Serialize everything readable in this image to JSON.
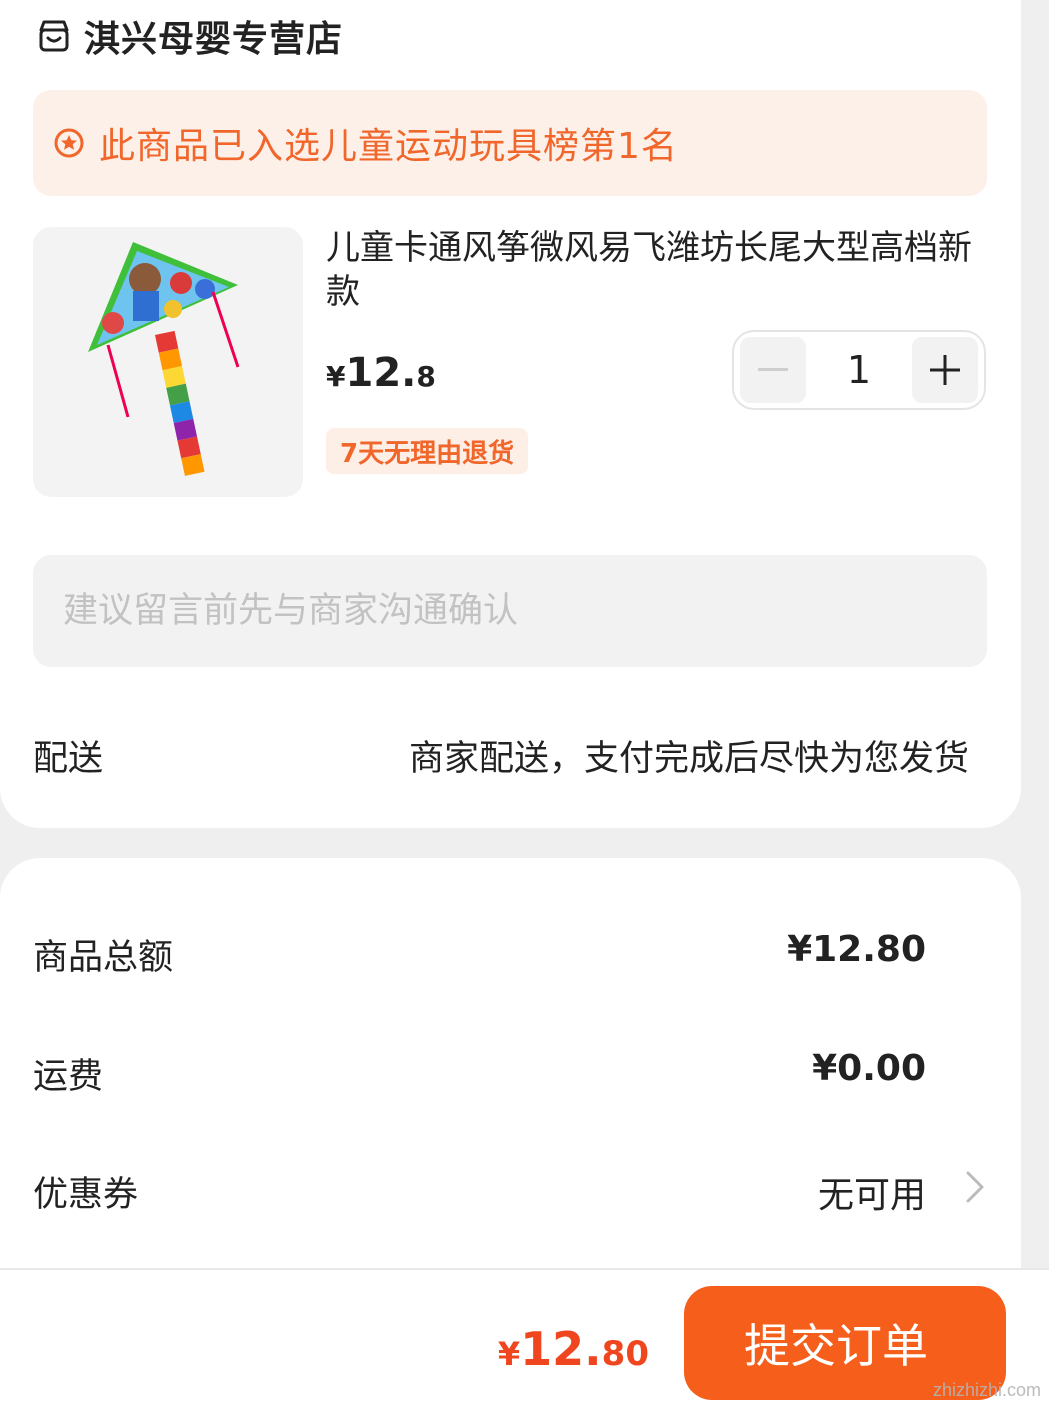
{
  "shop": {
    "name": "淇兴母婴专营店",
    "icon": "store-icon"
  },
  "rank_banner": {
    "text": "此商品已入选儿童运动玩具榜第1名",
    "icon": "award-icon",
    "color": "#f0662b"
  },
  "product": {
    "title": "儿童卡通风筝微风易飞潍坊长尾大型高档新款",
    "price_currency": "¥",
    "price_int": "12.",
    "price_dec": "8",
    "quantity": "1",
    "return_badge": "7天无理由退货"
  },
  "note": {
    "placeholder": "建议留言前先与商家沟通确认",
    "value": ""
  },
  "delivery": {
    "label": "配送",
    "value": "商家配送，支付完成后尽快为您发货"
  },
  "summary": {
    "goods_total_label": "商品总额",
    "goods_total_value": "¥12.80",
    "shipping_label": "运费",
    "shipping_value": "¥0.00",
    "coupon_label": "优惠券",
    "coupon_value": "无可用"
  },
  "footer": {
    "total_currency": "¥",
    "total_int": "12.",
    "total_dec": "80",
    "submit_label": "提交订单",
    "accent_color": "#f65f1b"
  },
  "watermark": "zhizhizhi.com"
}
